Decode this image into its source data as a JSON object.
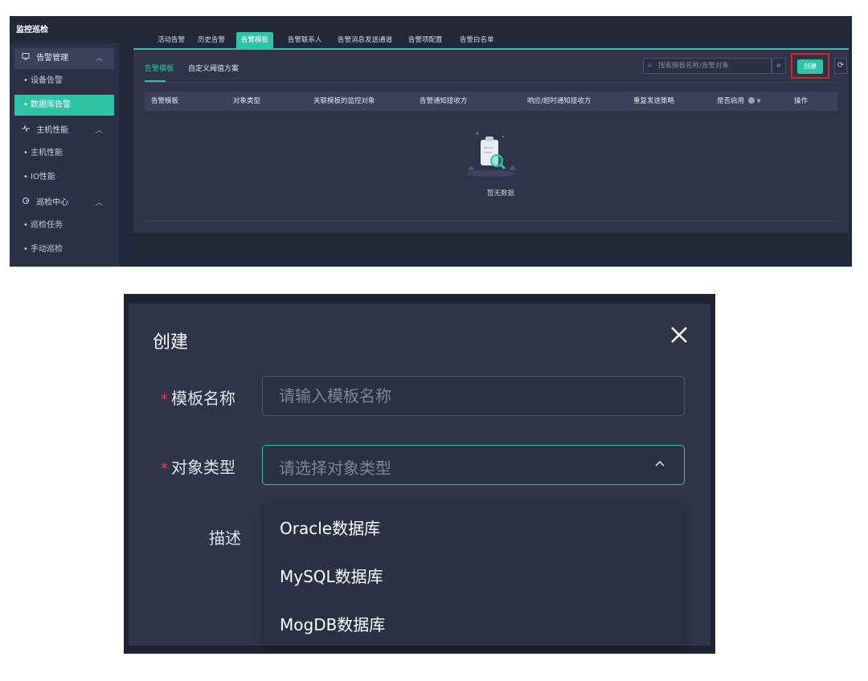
{
  "sidebar": {
    "header": "监控巡检",
    "items": [
      {
        "label": "告警管理",
        "kind": "group",
        "icon": "monitor-icon"
      },
      {
        "label": "设备告警",
        "kind": "sub"
      },
      {
        "label": "数据库告警",
        "kind": "sub",
        "active": true
      },
      {
        "label": "主机性能",
        "kind": "group",
        "icon": "pulse-icon"
      },
      {
        "label": "主机性能",
        "kind": "sub"
      },
      {
        "label": "IO性能",
        "kind": "sub"
      },
      {
        "label": "巡检中心",
        "kind": "group",
        "icon": "inspect-icon"
      },
      {
        "label": "巡检任务",
        "kind": "sub"
      },
      {
        "label": "手动巡检",
        "kind": "sub"
      }
    ]
  },
  "tabs": [
    "活动告警",
    "历史告警",
    "告警模板",
    "告警联系人",
    "告警消息发送通道",
    "告警项配置",
    "告警白名单"
  ],
  "active_tab": "告警模板",
  "subtabs": [
    "告警模板",
    "自定义阈值方案"
  ],
  "toolbar": {
    "search_placeholder": "搜索模板名称/告警对象",
    "create_label": "创建"
  },
  "table": {
    "columns": [
      "告警模板",
      "对象类型",
      "关联模板的监控对象",
      "告警通知接收方",
      "响应/超时通知接收方",
      "重复发送策略",
      "是否启用",
      "操作"
    ],
    "empty_text": "暂无数据"
  },
  "modal": {
    "title": "创建",
    "fields": {
      "template_name": {
        "label": "模板名称",
        "placeholder": "请输入模板名称",
        "required": true
      },
      "object_type": {
        "label": "对象类型",
        "placeholder": "请选择对象类型",
        "required": true
      },
      "description": {
        "label": "描述"
      }
    },
    "options": [
      "Oracle数据库",
      "MySQL数据库",
      "MogDB数据库"
    ]
  },
  "colors": {
    "accent": "#2ec4a5",
    "highlight_border": "#d9232e",
    "required": "#e2444d"
  }
}
